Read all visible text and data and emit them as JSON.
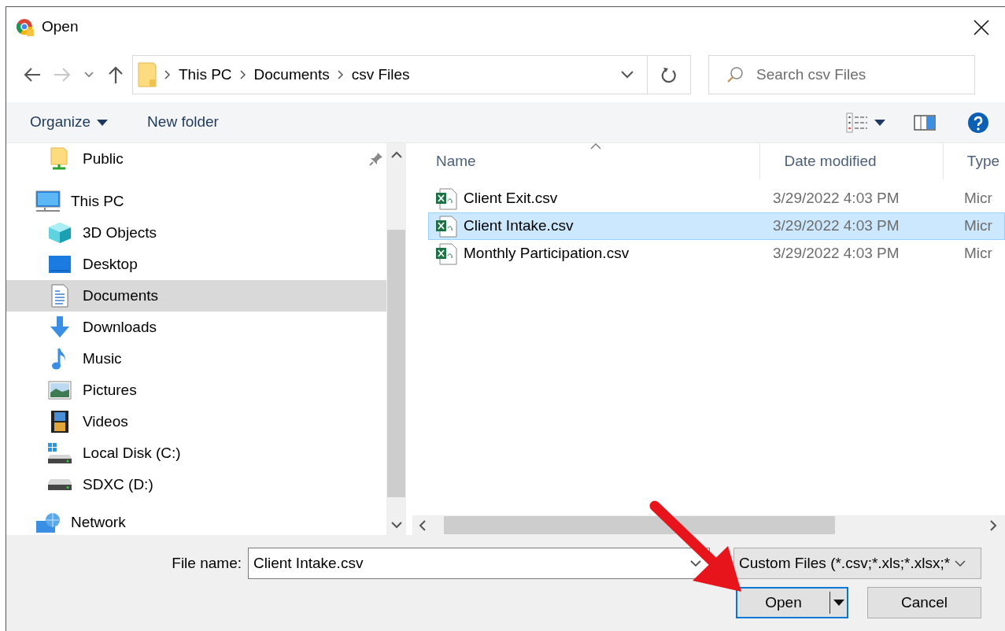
{
  "window": {
    "title": "Open"
  },
  "navigation": {
    "breadcrumb": [
      "This PC",
      "Documents",
      "csv Files"
    ],
    "search": {
      "placeholder": "Search csv Files"
    }
  },
  "toolbar": {
    "organize": "Organize",
    "new_folder": "New folder"
  },
  "sidebar": {
    "items": [
      {
        "label": "Public",
        "pinned": true,
        "selected": false
      },
      {
        "label": "This PC",
        "pinned": false,
        "selected": false,
        "children": [
          {
            "label": "3D Objects",
            "selected": false
          },
          {
            "label": "Desktop",
            "selected": false
          },
          {
            "label": "Documents",
            "selected": true
          },
          {
            "label": "Downloads",
            "selected": false
          },
          {
            "label": "Music",
            "selected": false
          },
          {
            "label": "Pictures",
            "selected": false
          },
          {
            "label": "Videos",
            "selected": false
          },
          {
            "label": "Local Disk (C:)",
            "selected": false
          },
          {
            "label": "SDXC (D:)",
            "selected": false
          }
        ]
      },
      {
        "label": "Network",
        "pinned": false,
        "selected": false
      }
    ]
  },
  "file_list": {
    "columns": [
      "Name",
      "Date modified",
      "Type"
    ],
    "rows": [
      {
        "name": "Client Exit.csv",
        "date": "3/29/2022 4:03 PM",
        "type": "Micr",
        "selected": false
      },
      {
        "name": "Client Intake.csv",
        "date": "3/29/2022 4:03 PM",
        "type": "Micr",
        "selected": true
      },
      {
        "name": "Monthly Participation.csv",
        "date": "3/29/2022 4:03 PM",
        "type": "Micr",
        "selected": false
      }
    ]
  },
  "footer": {
    "file_name_label": "File name:",
    "file_name": "Client Intake.csv",
    "file_type": "Custom Files (*.csv;*.xls;*.xlsx;*",
    "buttons": [
      {
        "label": "Open",
        "kind": "primary"
      },
      {
        "label": "Cancel",
        "kind": "default"
      }
    ]
  }
}
